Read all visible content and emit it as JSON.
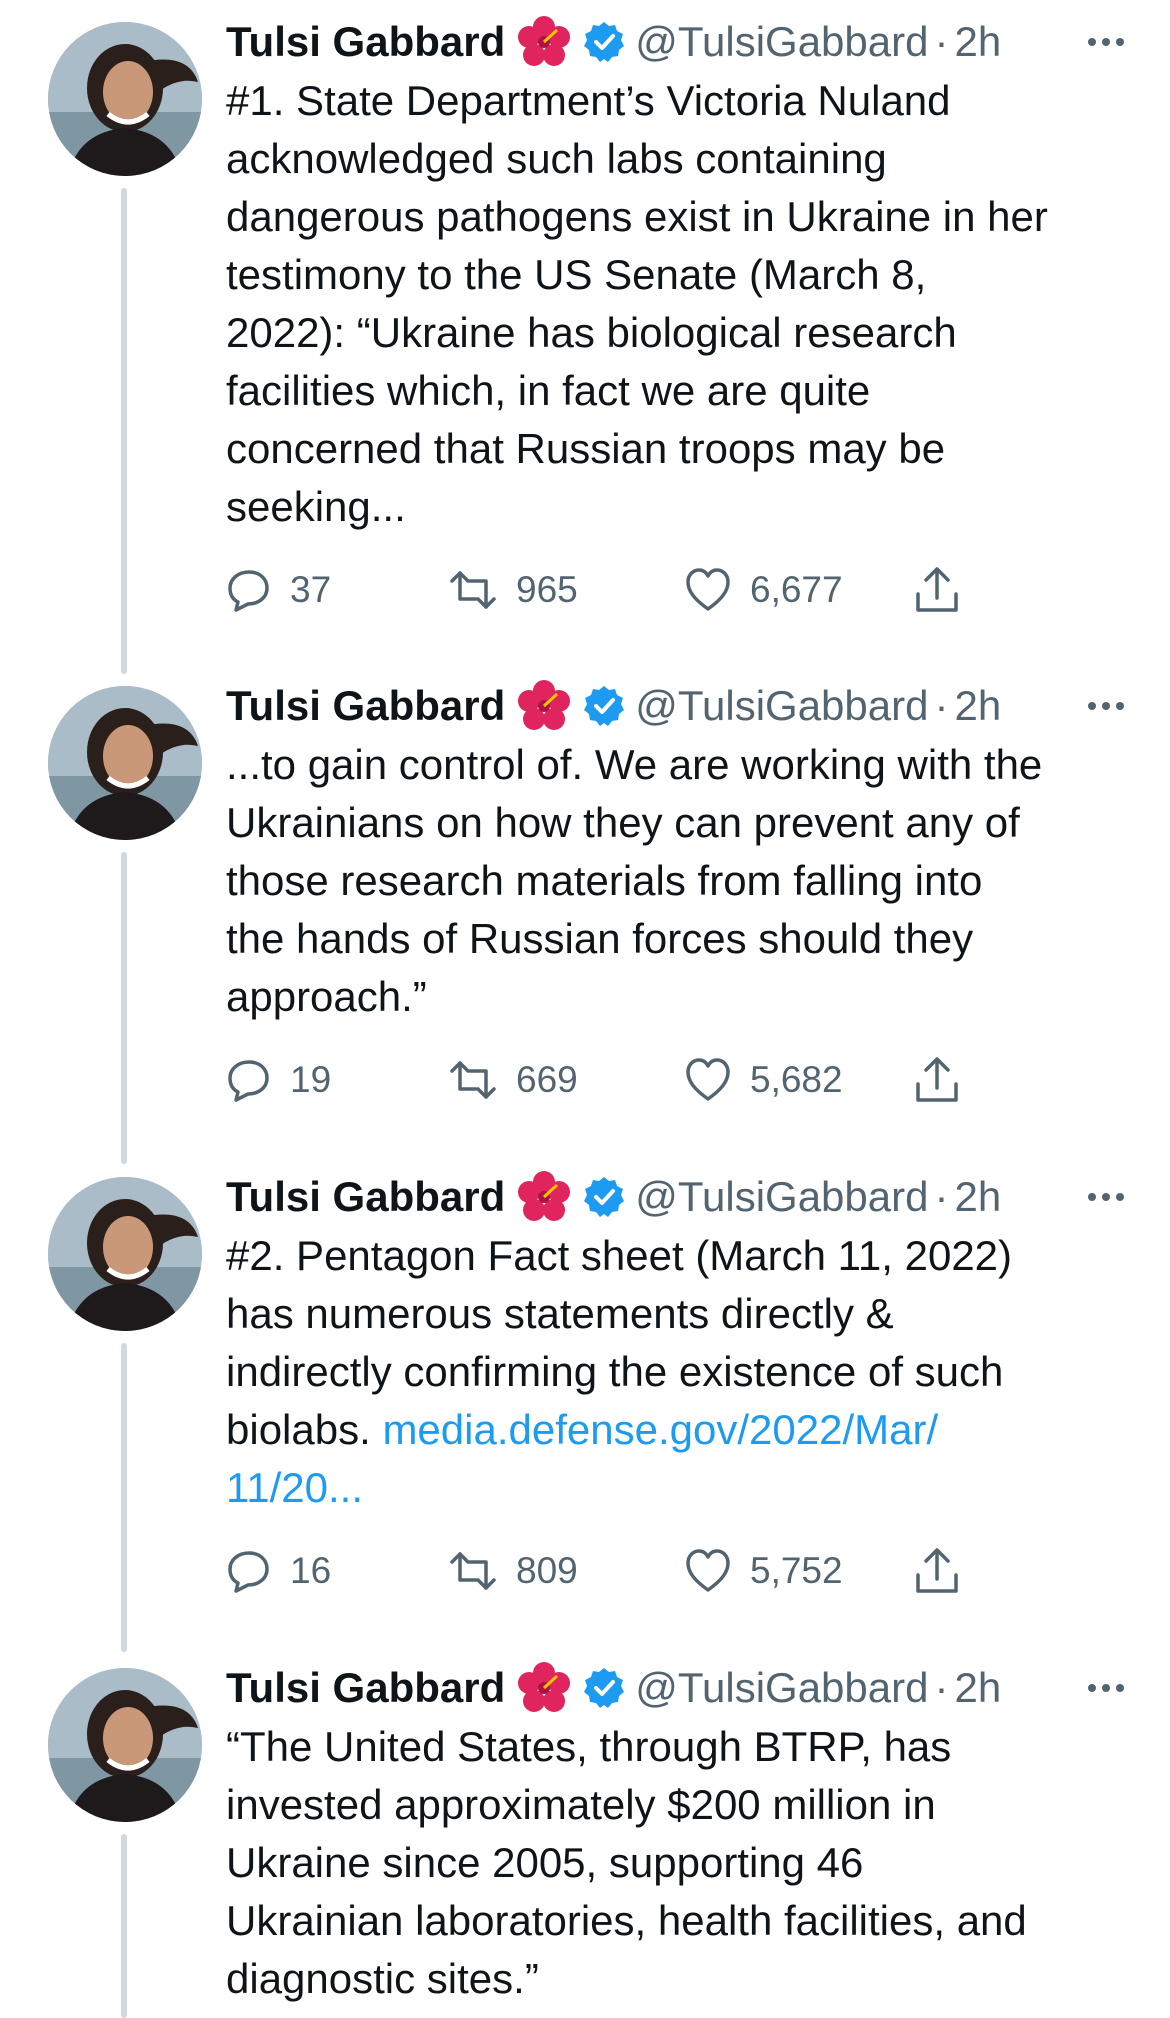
{
  "tweets": [
    {
      "name": "Tulsi Gabbard",
      "handle": "@TulsiGabbard",
      "separator": "·",
      "time": "2h",
      "text": "#1. State Department’s Victoria Nuland\nacknowledged such labs containing\ndangerous pathogens exist in Ukraine in her\ntestimony to the US Senate (March 8,\n2022): “Ukraine has biological research\nfacilities which, in fact we are quite\nconcerned that Russian troops may be\nseeking...",
      "replies": "37",
      "retweets": "965",
      "likes": "6,677"
    },
    {
      "name": "Tulsi Gabbard",
      "handle": "@TulsiGabbard",
      "separator": "·",
      "time": "2h",
      "text": "...to gain control of. We are working with the\nUkrainians on how they can prevent any of\nthose research materials from falling into\nthe hands of Russian forces should they\napproach.”",
      "replies": "19",
      "retweets": "669",
      "likes": "5,682"
    },
    {
      "name": "Tulsi Gabbard",
      "handle": "@TulsiGabbard",
      "separator": "·",
      "time": "2h",
      "text": "#2. Pentagon Fact sheet (March 11, 2022)\nhas numerous statements directly &\nindirectly confirming the existence of such\nbiolabs. ",
      "link": "media.defense.gov/2022/Mar/\n11/20...",
      "replies": "16",
      "retweets": "809",
      "likes": "5,752"
    },
    {
      "name": "Tulsi Gabbard",
      "handle": "@TulsiGabbard",
      "separator": "·",
      "time": "2h",
      "text": "“The United States, through BTRP, has\ninvested approximately $200 million in\nUkraine since 2005, supporting 46\nUkrainian laboratories, health facilities, and\ndiagnostic sites.”"
    }
  ],
  "icons": {
    "flower": "hibiscus-emoji",
    "verified": "verified-badge-icon",
    "more": "more-options-icon",
    "reply": "reply-icon",
    "retweet": "retweet-icon",
    "like": "like-icon",
    "share": "share-icon"
  },
  "colors": {
    "text": "#0f1419",
    "secondary": "#536471",
    "link": "#1d9bf0",
    "verified": "#1d9bf0",
    "thread": "#cfd9de"
  }
}
